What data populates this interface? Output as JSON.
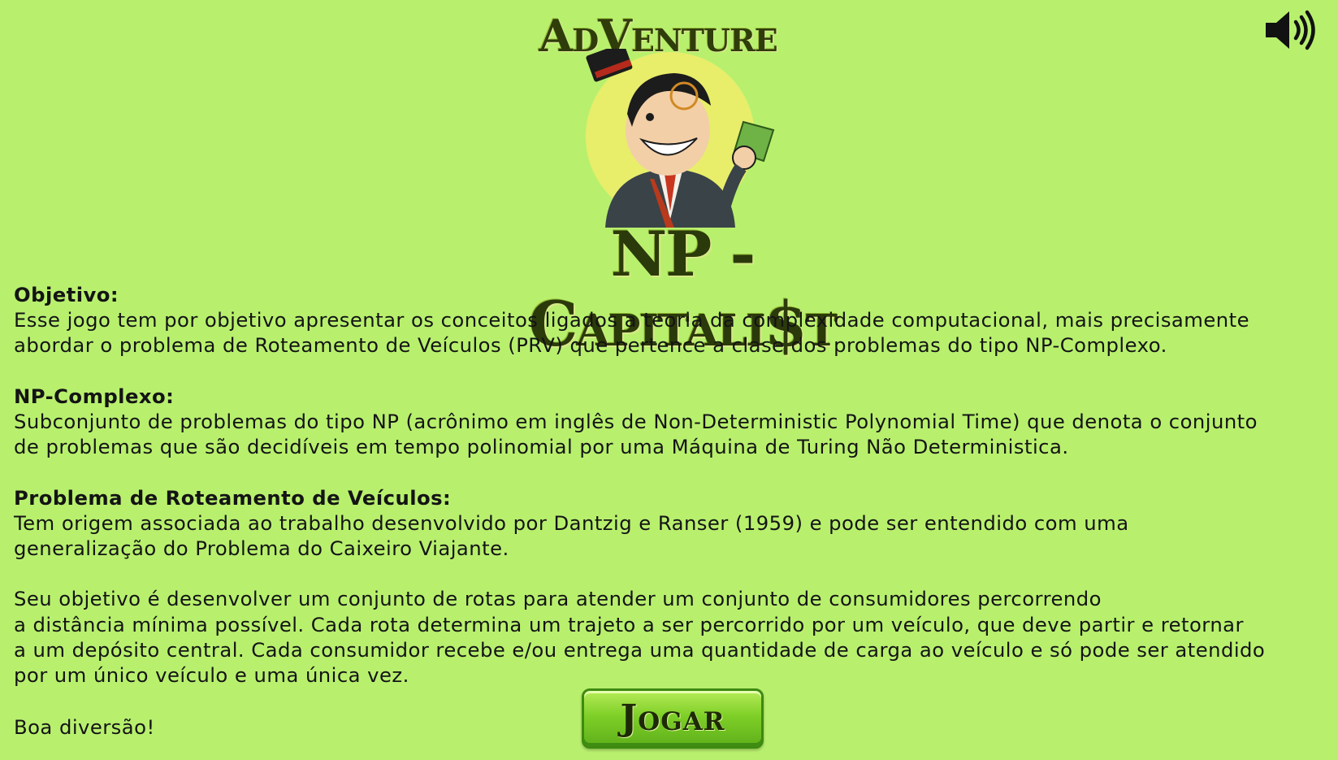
{
  "header": {
    "brand": "AdVenture",
    "title": "NP - Capitali$t"
  },
  "sound": {
    "icon": "speaker-volume-icon"
  },
  "sections": [
    {
      "title": "Objetivo:",
      "lines": [
        "Esse jogo tem por objetivo apresentar os conceitos ligados a teoria da complexidade computacional, mais precisamente",
        "abordar o problema de Roteamento de Veículos (PRV) que pertence a clase dos problemas do tipo NP-Complexo."
      ]
    },
    {
      "title": "NP-Complexo:",
      "lines": [
        "Subconjunto de problemas do tipo NP (acrônimo em inglês de Non-Deterministic Polynomial Time) que denota o conjunto",
        "de problemas que são decidíveis em tempo polinomial por uma Máquina de Turing Não Deterministica."
      ]
    },
    {
      "title": "Problema de Roteamento de Veículos:",
      "lines": [
        "Tem origem associada ao trabalho desenvolvido por Dantzig e Ranser (1959) e pode ser entendido com uma",
        "generalização do Problema do Caixeiro Viajante."
      ]
    }
  ],
  "paragraph": {
    "lines": [
      "Seu objetivo é desenvolver um conjunto de rotas para atender um conjunto de consumidores percorrendo",
      "a distância mínima possível. Cada rota determina um trajeto a ser percorrido por um veículo, que deve partir e retornar",
      "a um depósito central. Cada consumidor recebe e/ou entrega uma quantidade de carga ao veículo e só pode ser atendido",
      "por um único veículo e uma única vez."
    ]
  },
  "closing": "Boa diversão!",
  "play_button": {
    "label": "Jogar"
  },
  "colors": {
    "background": "#b8f06e",
    "title": "#2b3a0a",
    "button": "#7fcf28"
  }
}
